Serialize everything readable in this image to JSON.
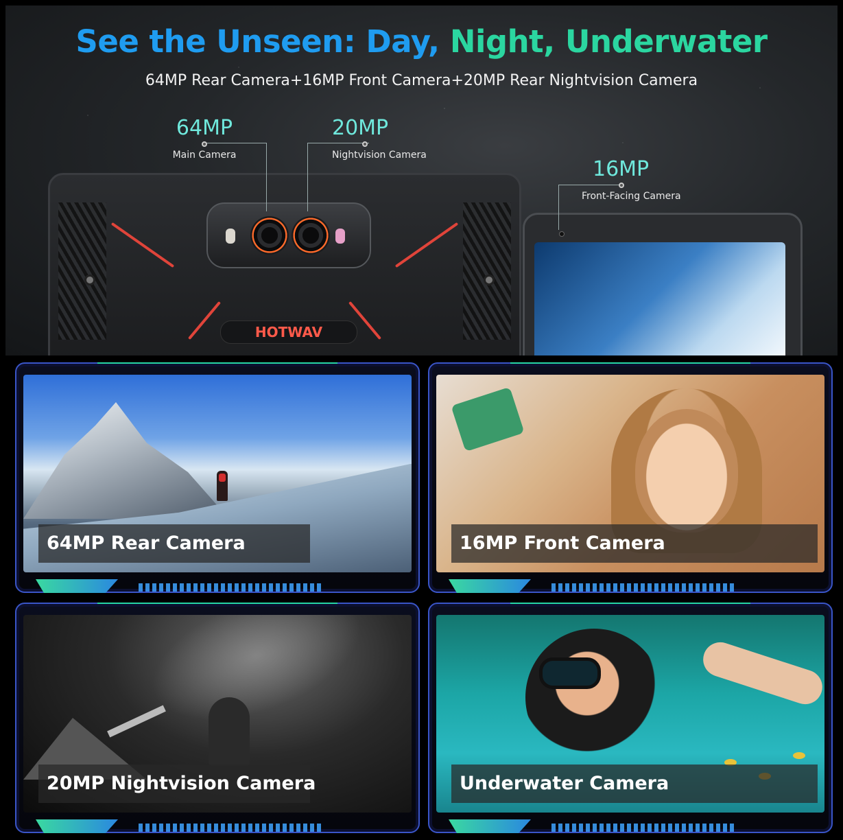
{
  "hero": {
    "headline_part1": "See the Unseen: Day,",
    "headline_part2": "Night, Underwater",
    "subline": "64MP Rear Camera+16MP Front Camera+20MP Rear Nightvision Camera",
    "brand": "HOTWAV",
    "callouts": [
      {
        "mp": "64MP",
        "label": "Main Camera"
      },
      {
        "mp": "20MP",
        "label": "Nightvision Camera"
      },
      {
        "mp": "16MP",
        "label": "Front-Facing Camera"
      }
    ],
    "colors": {
      "headline_blue": "#1f9cf0",
      "headline_green": "#2bd6a0",
      "callout_mp": "#6fe8dc",
      "accent_red": "#e0443a"
    }
  },
  "tiles": [
    {
      "caption": "64MP Rear Camera"
    },
    {
      "caption": "16MP Front Camera"
    },
    {
      "caption": "20MP Nightvision Camera"
    },
    {
      "caption": "Underwater Camera"
    }
  ]
}
